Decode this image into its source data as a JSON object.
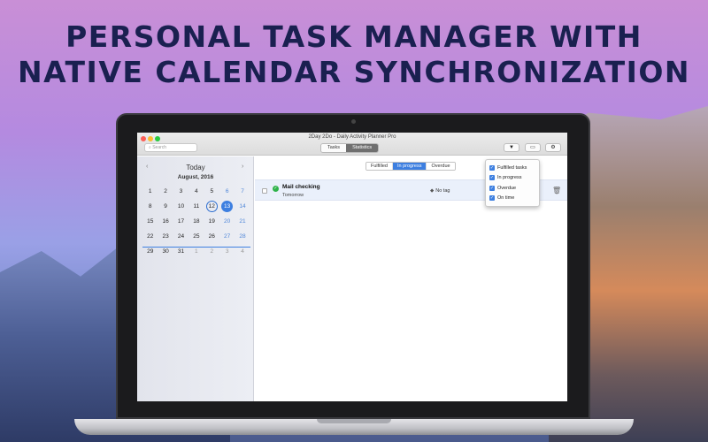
{
  "headline": {
    "line1": "Personal task manager with",
    "line2": "native calendar synchronization"
  },
  "window": {
    "title": "2Day 2Do - Daily Activity Planner Pro",
    "search_placeholder": "Search",
    "tabs": [
      {
        "label": "Tasks",
        "active": false
      },
      {
        "label": "Statistics",
        "active": true
      }
    ],
    "toolbar": {
      "filter_icon": "▼",
      "print_icon": "▭",
      "settings_icon": "⚙"
    }
  },
  "calendar": {
    "prev": "‹",
    "next": "›",
    "today_label": "Today",
    "month_label": "August, 2016",
    "selected_day": "12",
    "today_day": "13",
    "weeks": [
      [
        "1",
        "2",
        "3",
        "4",
        "5",
        "6",
        "7"
      ],
      [
        "8",
        "9",
        "10",
        "11",
        "12",
        "13",
        "14"
      ],
      [
        "15",
        "16",
        "17",
        "18",
        "19",
        "20",
        "21"
      ],
      [
        "22",
        "23",
        "24",
        "25",
        "26",
        "27",
        "28"
      ],
      [
        "29",
        "30",
        "31",
        "1",
        "2",
        "3",
        "4"
      ]
    ]
  },
  "filters": {
    "tabs": [
      {
        "label": "Fulfilled",
        "active": false
      },
      {
        "label": "In progress",
        "active": true
      },
      {
        "label": "Overdue",
        "active": false
      }
    ]
  },
  "task": {
    "title": "Mail checking",
    "due": "Tomorrow",
    "tag": "No tag",
    "status_icon": "✓",
    "trash_icon": "🗑"
  },
  "dropdown": {
    "items": [
      {
        "label": "Fulfilled tasks",
        "checked": true
      },
      {
        "label": "In progress",
        "checked": true
      },
      {
        "label": "Overdue",
        "checked": true
      },
      {
        "label": "On time",
        "checked": true
      }
    ]
  },
  "colors": {
    "accent": "#3d7fe0",
    "headline": "#1a2050",
    "status_green": "#2fb34a"
  }
}
